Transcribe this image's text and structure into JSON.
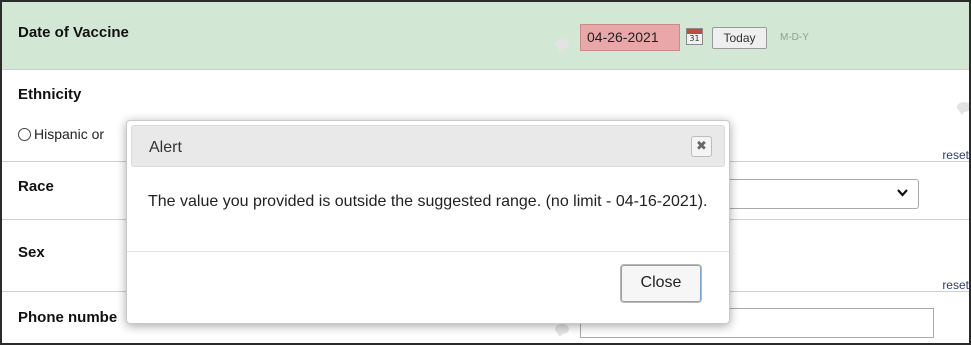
{
  "form": {
    "vaccine": {
      "label": "Date of Vaccine",
      "date_value": "04-26-2021",
      "calendar_day": "31",
      "today_label": "Today",
      "format_hint": "M-D-Y"
    },
    "ethnicity": {
      "label": "Ethnicity",
      "option_label": "Hispanic or",
      "reset_label": "reset"
    },
    "race": {
      "label": "Race"
    },
    "sex": {
      "label": "Sex",
      "reset_label": "reset"
    },
    "phone": {
      "label": "Phone numbe"
    }
  },
  "dialog": {
    "title": "Alert",
    "close_icon_glyph": "✖",
    "message": "The value you provided is outside the suggested range. (no limit - 04-16-2021).",
    "close_button_label": "Close"
  },
  "colors": {
    "vaccine_row_bg": "#d3e7d5",
    "date_error_bg": "#e9a7a9",
    "reset_link": "#2a3c7a"
  },
  "icons": {
    "calendar": "calendar-icon",
    "comment": "comment-bubble-icon",
    "dropdown": "chevron-down-icon",
    "close": "close-icon"
  }
}
